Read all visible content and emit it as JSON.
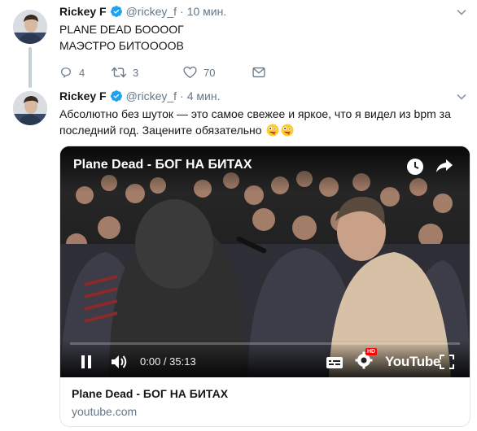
{
  "tweets": [
    {
      "author_name": "Rickey F",
      "handle": "@rickey_f",
      "separator": "·",
      "time": "10 мин.",
      "lines": [
        "PLANE DEAD БОООOГ",
        "МАЭСТРО БИТООООВ"
      ],
      "replies": "4",
      "retweets": "3",
      "likes": "70"
    },
    {
      "author_name": "Rickey F",
      "handle": "@rickey_f",
      "separator": "·",
      "time": "4 мин.",
      "line1": "Абсолютно без шуток — это самое свежее и яркое, что я видел из bpm за",
      "line2": "последний год. Зацените обязательно"
    }
  ],
  "card": {
    "video_title": "Plane Dead - БОГ НА БИТАХ",
    "time_display": "0:00 / 35:13",
    "youtube_label": "YouTube",
    "hd_badge": "HD",
    "title": "Plane Dead - БОГ НА БИТАХ",
    "domain": "youtube.com",
    "progress": 0
  },
  "icons": {
    "verified": "verified-badge-icon",
    "reply": "reply-icon",
    "retweet": "retweet-icon",
    "like": "heart-icon",
    "message": "envelope-icon",
    "menu": "chevron-down-icon",
    "emoji": "zany-face-emoji"
  },
  "colors": {
    "verified": "#1da1f2",
    "muted": "#657786",
    "text": "#14171a",
    "youtube_red": "#ff0000"
  }
}
